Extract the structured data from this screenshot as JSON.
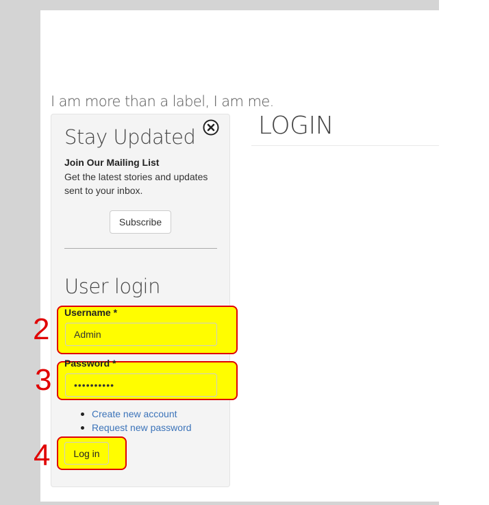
{
  "site": {
    "slogan": "I am more than a label, I am me."
  },
  "newsletter": {
    "title": "Stay Updated",
    "heading": "Join Our Mailing List",
    "description": "Get the latest stories and updates sent to your inbox.",
    "subscribe_label": "Subscribe",
    "close_icon": "close-icon"
  },
  "login_block": {
    "title": "User login",
    "username_label": "Username",
    "password_label": "Password",
    "required_marker": "*",
    "username_value": "Admin",
    "password_value": "••••••••••",
    "links": [
      "Create new account",
      "Request new password"
    ],
    "submit_label": "Log in"
  },
  "main": {
    "title": "LOGIN"
  },
  "annotations": {
    "step_username": "2",
    "step_password": "3",
    "step_login": "4"
  },
  "colors": {
    "highlight": "#fffd00",
    "annotation": "#e00000",
    "link": "#3b73b9"
  }
}
